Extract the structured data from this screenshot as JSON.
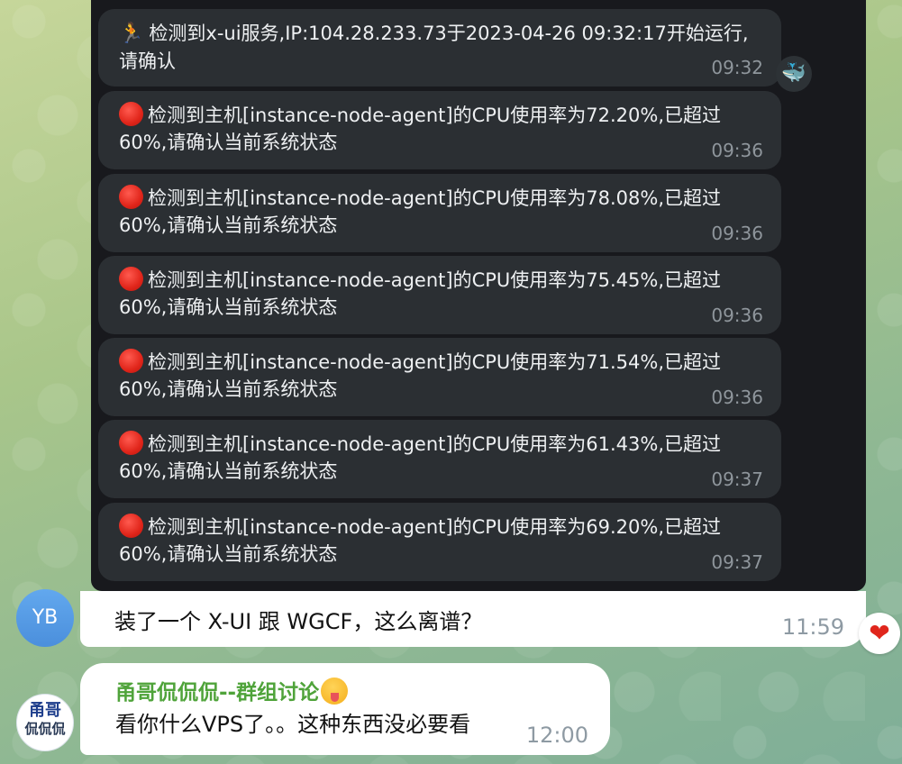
{
  "screenshot": {
    "messages": [
      {
        "icon": "runner-icon",
        "text": "检测到x-ui服务,IP:104.28.233.73于2023-04-26 09:32:17开始运行,请确认",
        "time": "09:32"
      },
      {
        "icon": "red-circle-icon",
        "text": "检测到主机[instance-node-agent]的CPU使用率为72.20%,已超过60%,请确认当前系统状态",
        "time": "09:36"
      },
      {
        "icon": "red-circle-icon",
        "text": "检测到主机[instance-node-agent]的CPU使用率为78.08%,已超过60%,请确认当前系统状态",
        "time": "09:36"
      },
      {
        "icon": "red-circle-icon",
        "text": "检测到主机[instance-node-agent]的CPU使用率为75.45%,已超过60%,请确认当前系统状态",
        "time": "09:36"
      },
      {
        "icon": "red-circle-icon",
        "text": "检测到主机[instance-node-agent]的CPU使用率为71.54%,已超过60%,请确认当前系统状态",
        "time": "09:36"
      },
      {
        "icon": "red-circle-icon",
        "text": "检测到主机[instance-node-agent]的CPU使用率为61.43%,已超过60%,请确认当前系统状态",
        "time": "09:37"
      },
      {
        "icon": "red-circle-icon",
        "text": "检测到主机[instance-node-agent]的CPU使用率为69.20%,已超过60%,请确认当前系统状态",
        "time": "09:37"
      }
    ],
    "bot_avatar_icon": "whale-icon"
  },
  "chat": {
    "msg1": {
      "avatar_initials": "YB",
      "avatar_color": "#5a9ee8",
      "text": "装了一个 X-UI 跟 WGCF，这么离谱？",
      "time": "11:59",
      "reaction": "heart-icon"
    },
    "msg2": {
      "avatar_line1": "甬哥",
      "avatar_line2": "侃侃侃",
      "sender": "甬哥侃侃侃--群组讨论",
      "sender_emoji": "tongue-out-emoji",
      "sender_color": "#4fa33a",
      "text": "看你什么VPS了。。这种东西没必要看",
      "time": "12:00"
    }
  }
}
